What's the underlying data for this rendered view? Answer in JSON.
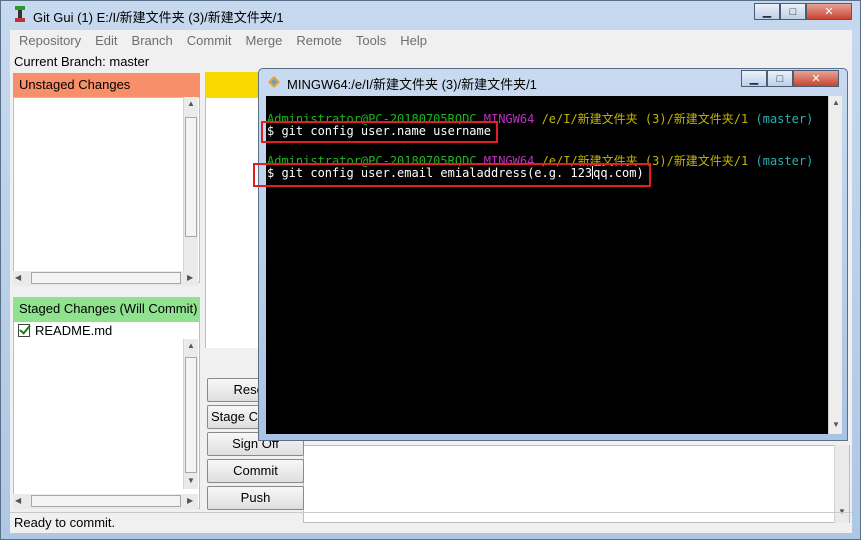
{
  "gitgui": {
    "title": "Git Gui (1) E:/I/新建文件夹 (3)/新建文件夹/1",
    "window_buttons": {
      "minimize": "▁",
      "maximize": "□",
      "close": "✕"
    },
    "menu": [
      "Repository",
      "Edit",
      "Branch",
      "Commit",
      "Merge",
      "Remote",
      "Tools",
      "Help"
    ],
    "current_branch": "Current Branch: master",
    "unstaged_header": "Unstaged Changes",
    "staged_header": "Staged Changes (Will Commit)",
    "staged_files": [
      {
        "name": "README.md",
        "icon": "checked-file-icon"
      }
    ],
    "buttons": {
      "rescan": "Rescan",
      "stage_changed": "Stage Changed",
      "sign_off": "Sign Off",
      "commit": "Commit",
      "push": "Push"
    },
    "status": "Ready to commit."
  },
  "terminal": {
    "title": "MINGW64:/e/I/新建文件夹 (3)/新建文件夹/1",
    "window_buttons": {
      "minimize": "▁",
      "maximize": "□",
      "close": "✕"
    },
    "prompt_user": "Administrator@PC-20180705RQDC",
    "prompt_env": "MINGW64",
    "prompt_path": "/e/I/新建文件夹 (3)/新建文件夹/1",
    "prompt_branch": "(master)",
    "commands": [
      "$ git config user.name username",
      "$ git config user.email emialaddress(e.g. 123",
      "qq.com)"
    ]
  },
  "colors": {
    "unstaged_header": "#f7906a",
    "staged_header": "#8fe38f",
    "highlight": "#e02020",
    "prompt_green": "#1fb51f",
    "prompt_magenta": "#c030c0",
    "prompt_yellow": "#c4b400",
    "prompt_cyan": "#24b0b8"
  }
}
